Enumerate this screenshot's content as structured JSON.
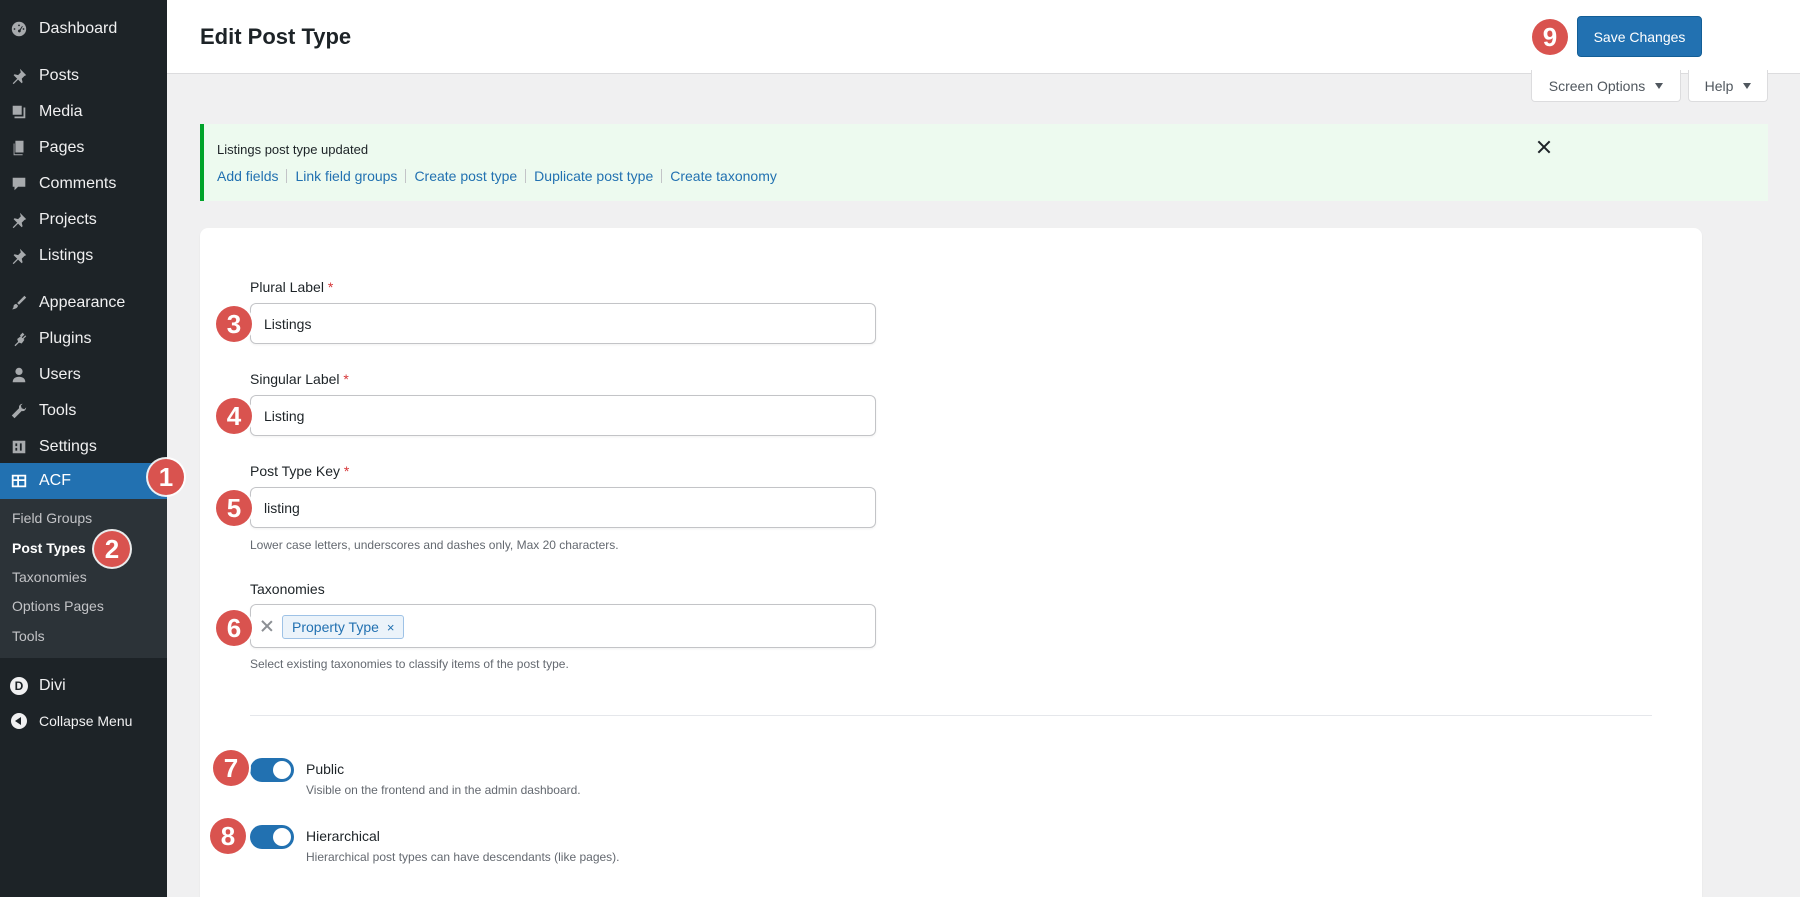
{
  "sidebar": {
    "items": [
      {
        "label": "Dashboard",
        "icon": "dashboard-icon"
      },
      {
        "label": "Posts",
        "icon": "pin-icon"
      },
      {
        "label": "Media",
        "icon": "media-icon"
      },
      {
        "label": "Pages",
        "icon": "pages-icon"
      },
      {
        "label": "Comments",
        "icon": "comment-icon"
      },
      {
        "label": "Projects",
        "icon": "pin-icon"
      },
      {
        "label": "Listings",
        "icon": "pin-icon"
      },
      {
        "label": "Appearance",
        "icon": "brush-icon"
      },
      {
        "label": "Plugins",
        "icon": "plugin-icon"
      },
      {
        "label": "Users",
        "icon": "user-icon"
      },
      {
        "label": "Tools",
        "icon": "wrench-icon"
      },
      {
        "label": "Settings",
        "icon": "settings-icon"
      },
      {
        "label": "ACF",
        "icon": "acf-table-icon"
      }
    ],
    "submenu": [
      "Field Groups",
      "Post Types",
      "Taxonomies",
      "Options Pages",
      "Tools"
    ],
    "divi_label": "Divi",
    "divi_letter": "D",
    "collapse_label": "Collapse Menu"
  },
  "header": {
    "title": "Edit Post Type",
    "save_label": "Save Changes",
    "screen_options": "Screen Options",
    "help": "Help"
  },
  "notice": {
    "message": "Listings post type updated",
    "links": [
      "Add fields",
      "Link field groups",
      "Create post type",
      "Duplicate post type",
      "Create taxonomy"
    ]
  },
  "form": {
    "plural": {
      "label": "Plural Label",
      "required_mark": "*",
      "value": "Listings"
    },
    "singular": {
      "label": "Singular Label",
      "required_mark": "*",
      "value": "Listing"
    },
    "key": {
      "label": "Post Type Key",
      "required_mark": "*",
      "value": "listing",
      "help": "Lower case letters, underscores and dashes only, Max 20 characters."
    },
    "taxonomies": {
      "label": "Taxonomies",
      "selected": "Property Type",
      "remove_glyph": "×",
      "help": "Select existing taxonomies to classify items of the post type."
    },
    "public": {
      "label": "Public",
      "description": "Visible on the frontend and in the admin dashboard.",
      "on": true
    },
    "hierarchical": {
      "label": "Hierarchical",
      "description": "Hierarchical post types can have descendants (like pages).",
      "on": true
    }
  },
  "badges": [
    "1",
    "2",
    "3",
    "4",
    "5",
    "6",
    "7",
    "8",
    "9"
  ],
  "colors": {
    "accent": "#2271b1",
    "badge": "#d9534f",
    "sidebar": "#1d2327",
    "notice_border": "#00a32a"
  }
}
